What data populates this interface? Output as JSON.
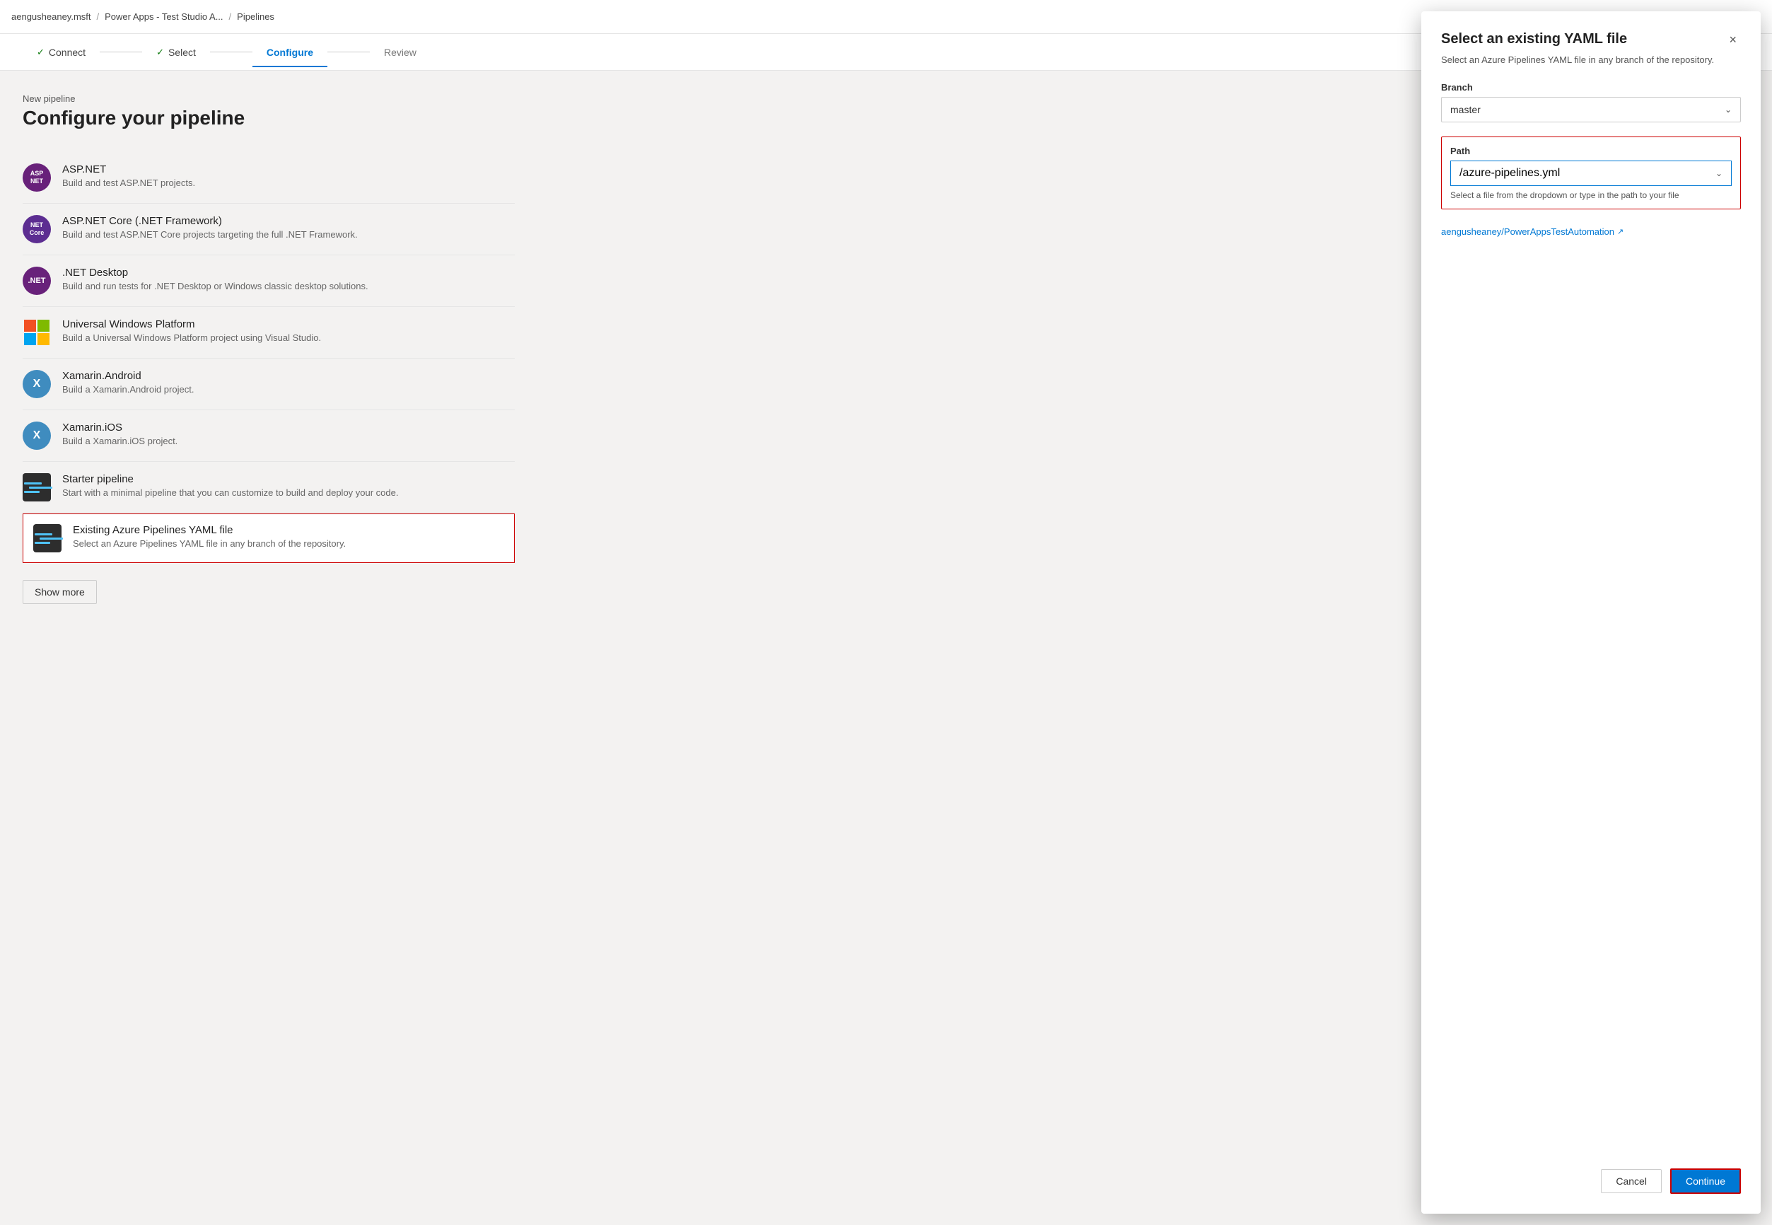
{
  "topbar": {
    "org": "aengusheaney.msft",
    "sep1": "/",
    "project": "Power Apps - Test Studio A...",
    "sep2": "/",
    "current": "Pipelines"
  },
  "wizard": {
    "steps": [
      {
        "id": "connect",
        "label": "Connect",
        "state": "completed"
      },
      {
        "id": "select",
        "label": "Select",
        "state": "completed"
      },
      {
        "id": "configure",
        "label": "Configure",
        "state": "active"
      },
      {
        "id": "review",
        "label": "Review",
        "state": "inactive"
      }
    ]
  },
  "page": {
    "new_pipeline_label": "New pipeline",
    "configure_title": "Configure your pipeline",
    "show_more_label": "Show more"
  },
  "pipeline_options": [
    {
      "id": "aspnet",
      "icon_type": "aspnet",
      "icon_label": "ASP\nNET",
      "title": "ASP.NET",
      "desc": "Build and test ASP.NET projects."
    },
    {
      "id": "aspnet-core",
      "icon_type": "aspnet-core",
      "icon_label": "NET\nCore",
      "title": "ASP.NET Core (.NET Framework)",
      "desc": "Build and test ASP.NET Core projects targeting the full .NET Framework."
    },
    {
      "id": "net-desktop",
      "icon_type": "net-desktop",
      "icon_label": ".NET",
      "title": ".NET Desktop",
      "desc": "Build and run tests for .NET Desktop or Windows classic desktop solutions."
    },
    {
      "id": "uwp",
      "icon_type": "uwp",
      "icon_label": "UWP",
      "title": "Universal Windows Platform",
      "desc": "Build a Universal Windows Platform project using Visual Studio."
    },
    {
      "id": "xamarin-android",
      "icon_type": "xamarin-android",
      "icon_label": "X",
      "title": "Xamarin.Android",
      "desc": "Build a Xamarin.Android project."
    },
    {
      "id": "xamarin-ios",
      "icon_type": "xamarin-ios",
      "icon_label": "X",
      "title": "Xamarin.iOS",
      "desc": "Build a Xamarin.iOS project."
    },
    {
      "id": "starter",
      "icon_type": "starter",
      "icon_label": "≡",
      "title": "Starter pipeline",
      "desc": "Start with a minimal pipeline that you can customize to build and deploy your code."
    },
    {
      "id": "existing-yaml",
      "icon_type": "existing",
      "icon_label": "≡",
      "title": "Existing Azure Pipelines YAML file",
      "desc": "Select an Azure Pipelines YAML file in any branch of the repository.",
      "selected": true
    }
  ],
  "modal": {
    "title": "Select an existing YAML file",
    "subtitle": "Select an Azure Pipelines YAML file in any branch of the repository.",
    "close_label": "×",
    "branch_label": "Branch",
    "branch_value": "master",
    "path_label": "Path",
    "path_value": "/azure-pipelines.yml",
    "path_hint": "Select a file from the dropdown or type in the path to your file",
    "repo_link_label": "aengusheaney/PowerAppsTestAutomation",
    "repo_link_icon": "↗",
    "cancel_label": "Cancel",
    "continue_label": "Continue"
  }
}
